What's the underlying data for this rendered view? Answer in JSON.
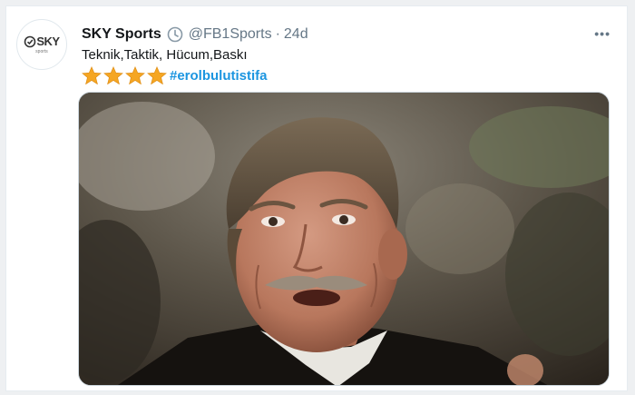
{
  "tweet": {
    "display_name": "SKY Sports",
    "handle": "@FB1Sports",
    "separator": "·",
    "time": "24d",
    "text": "Teknik,Taktik, Hücum,Baskı",
    "rating_stars": 4,
    "hashtag": "#erolbulutistifa",
    "more_label": "•••"
  },
  "avatar": {
    "logo_text": "SKY",
    "logo_subtext": "sports"
  },
  "icons": {
    "verified": "clock-badge-icon",
    "star": "star-icon",
    "more": "more-options-icon"
  },
  "colors": {
    "name": "#14171a",
    "muted": "#657786",
    "hashtag": "#1b95e0",
    "star": "#f5a623"
  },
  "media": {
    "description_alt": "photo"
  }
}
